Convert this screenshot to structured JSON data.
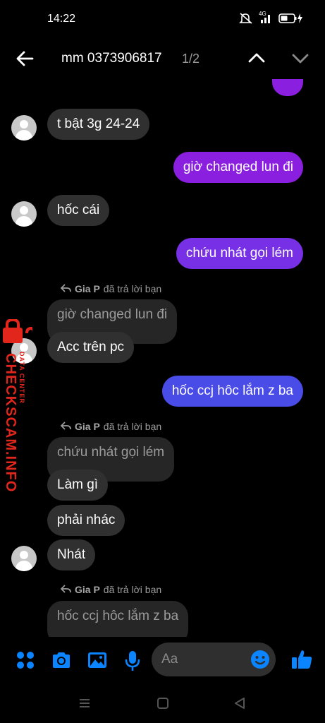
{
  "status_bar": {
    "time": "14:22",
    "network_label": "4G",
    "icons": [
      "mute-icon",
      "signal-icon",
      "battery-charging-icon"
    ]
  },
  "header": {
    "search_title": "mm 0373906817",
    "result_count": "1/2",
    "icons": [
      "back-arrow-icon",
      "chevron-up-icon",
      "chevron-down-icon"
    ]
  },
  "messages": [
    {
      "side": "in",
      "text": "t bật 3g 24-24"
    },
    {
      "side": "out",
      "text": "giờ changed lun đi"
    },
    {
      "side": "in",
      "text": "hốc cái"
    },
    {
      "side": "out",
      "text": "chứu nhát gọi lém"
    },
    {
      "side": "in",
      "reply_label": {
        "name": "Gia P",
        "text": "đã trả lời bạn"
      },
      "quoted": "giờ changed lun đi",
      "text": "Acc trên pc"
    },
    {
      "side": "out",
      "text": "hốc ccj hôc lắm z ba"
    },
    {
      "side": "in",
      "reply_label": {
        "name": "Gia P",
        "text": "đã trả lời bạn"
      },
      "quoted": "chứu nhát gọi lém",
      "text": "Làm gì"
    },
    {
      "side": "in",
      "text": "phải nhác"
    },
    {
      "side": "in",
      "text": "Nhát"
    },
    {
      "side": "in",
      "reply_label": {
        "name": "Gia P",
        "text": "đã trả lời bạn"
      },
      "quoted": "hốc ccj hôc lắm z ba"
    }
  ],
  "composer": {
    "placeholder": "Aa",
    "icons": [
      "apps-icon",
      "camera-icon",
      "gallery-icon",
      "microphone-icon",
      "emoji-icon",
      "thumbs-up-icon"
    ],
    "accent_color": "#0a84ff"
  },
  "system_nav": {
    "icons": [
      "recents-icon",
      "home-icon",
      "back-triangle-icon"
    ]
  },
  "watermark": {
    "main": "CHECKSCAM.INFO",
    "sub": "DATA CENTER",
    "color": "#e3261c"
  },
  "colors": {
    "incoming_bubble": "#303030",
    "outgoing_purple": "#8b1fdf",
    "outgoing_violet": "#7730e6",
    "outgoing_blue": "#4a4ce8"
  }
}
